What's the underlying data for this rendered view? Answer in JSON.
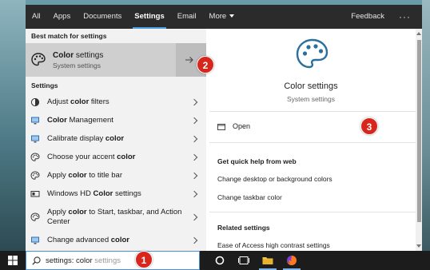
{
  "tabs": [
    "All",
    "Apps",
    "Documents",
    "Settings",
    "Email",
    "More"
  ],
  "active_tab": "Settings",
  "feedback_label": "Feedback",
  "more_dots": "···",
  "best_match_header": "Best match for settings",
  "best_match": {
    "title_bold": "Color",
    "title_rest": " settings",
    "subtitle": "System settings"
  },
  "settings_header": "Settings",
  "settings_items": [
    {
      "pre": "Adjust ",
      "bold": "color",
      "post": " filters",
      "icon": "color-filter-icon"
    },
    {
      "pre": "",
      "bold": "Color",
      "post": " Management",
      "icon": "monitor-icon"
    },
    {
      "pre": "Calibrate display ",
      "bold": "color",
      "post": "",
      "icon": "monitor-icon"
    },
    {
      "pre": "Choose your accent ",
      "bold": "color",
      "post": "",
      "icon": "palette-icon"
    },
    {
      "pre": "Apply ",
      "bold": "color",
      "post": " to title bar",
      "icon": "palette-icon"
    },
    {
      "pre": "Windows HD ",
      "bold": "Color",
      "post": " settings",
      "icon": "hd-display-icon"
    },
    {
      "pre": "Apply ",
      "bold": "color",
      "post": " to Start, taskbar, and Action Center",
      "icon": "palette-icon"
    },
    {
      "pre": "Change advanced ",
      "bold": "color",
      "post": "",
      "icon": "monitor-icon"
    }
  ],
  "detail": {
    "title": "Color settings",
    "subtitle": "System settings",
    "open_label": "Open",
    "quick_help_header": "Get quick help from web",
    "quick_help_links": [
      "Change desktop or background colors",
      "Change taskbar color"
    ],
    "related_header": "Related settings",
    "related_links": [
      "Ease of Access high contrast settings"
    ]
  },
  "search": {
    "typed": "settings: color",
    "suggestion": " settings"
  },
  "badges": [
    "1",
    "2",
    "3"
  ],
  "colors": {
    "badge_red": "#d9261c",
    "tab_bar": "#2b2b2b",
    "active_tab_underline": "#4ca0e0",
    "taskbar": "#1c1c1c"
  }
}
